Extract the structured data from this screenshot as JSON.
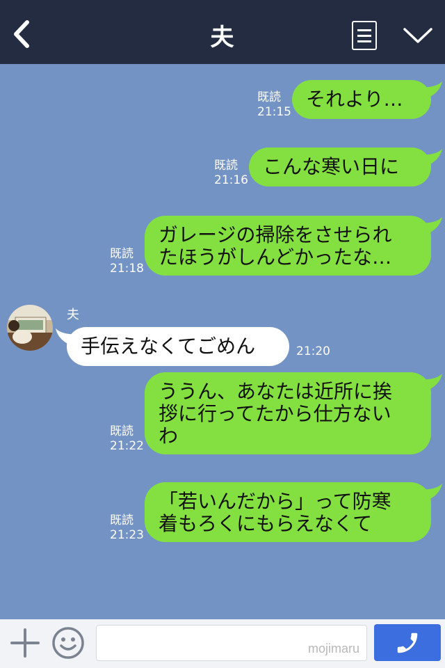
{
  "header": {
    "title": "夫",
    "back_icon": "chevron-left-icon",
    "menu_icon": "menu-list-icon",
    "dropdown_icon": "chevron-down-icon"
  },
  "colors": {
    "header_bg": "#232c41",
    "chat_bg": "#7293c4",
    "my_bubble": "#84e041",
    "their_bubble": "#ffffff",
    "call_button": "#3d6ee0"
  },
  "sender_name": "夫",
  "messages": [
    {
      "from": "me",
      "lines": [
        "それより…"
      ],
      "read": "既読",
      "time": "21:15"
    },
    {
      "from": "me",
      "lines": [
        "こんな寒い日に"
      ],
      "read": "既読",
      "time": "21:16"
    },
    {
      "from": "me",
      "lines": [
        "ガレージの掃除をさせられ",
        "たほうがしんどかったな…"
      ],
      "read": "既読",
      "time": "21:18"
    },
    {
      "from": "them",
      "lines": [
        "手伝えなくてごめん"
      ],
      "time": "21:20"
    },
    {
      "from": "me",
      "lines": [
        "ううん、あなたは近所に挨",
        "拶に行ってたから仕方ない",
        "わ"
      ],
      "read": "既読",
      "time": "21:22"
    },
    {
      "from": "me",
      "lines": [
        "「若いんだから」って防寒",
        "着もろくにもらえなくて"
      ],
      "read": "既読",
      "time": "21:23"
    }
  ],
  "input": {
    "placeholder": "",
    "watermark": "mojimaru"
  }
}
